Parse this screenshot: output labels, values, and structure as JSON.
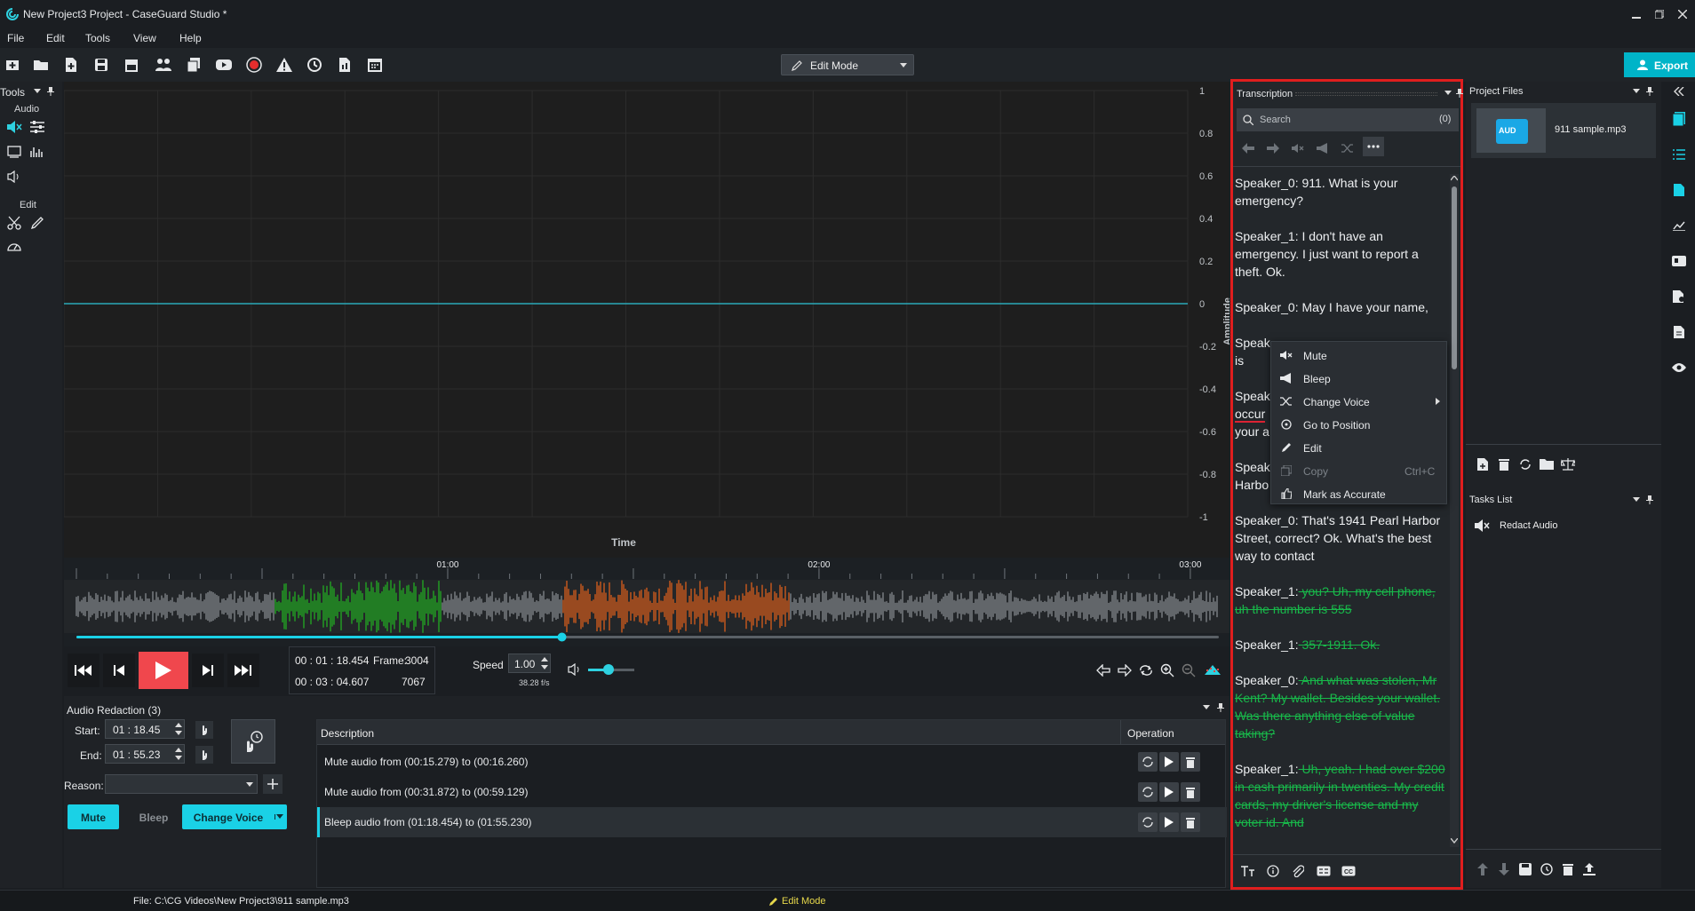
{
  "window": {
    "title": "New Project3 Project - CaseGuard Studio *"
  },
  "menu": [
    "File",
    "Edit",
    "Tools",
    "View",
    "Help"
  ],
  "toolbar": {
    "mode": "Edit Mode",
    "export": "Export"
  },
  "tools_panel": {
    "title": "Tools",
    "audio": "Audio",
    "edit": "Edit"
  },
  "chart_data": {
    "type": "line",
    "ylabel": "Amplitude",
    "xlabel": "Time",
    "y_ticks": [
      "1",
      "0.8",
      "0.6",
      "0.4",
      "0.2",
      "0",
      "-0.2",
      "-0.4",
      "-0.6",
      "-0.8",
      "-1"
    ],
    "ylim": [
      -1,
      1
    ],
    "series": [
      {
        "values": [
          0,
          0
        ]
      }
    ],
    "grid": true
  },
  "timeline": {
    "ticks": [
      "01:00",
      "02:00",
      "03:00"
    ],
    "duration_seconds": 184.607,
    "playhead_seconds": 78.454,
    "selections": [
      {
        "start": 31.872,
        "end": 59.129,
        "color": "#22b722"
      },
      {
        "start": 78.454,
        "end": 115.23,
        "color": "#e8641a"
      }
    ]
  },
  "transport": {
    "current": "00 : 01 : 18.454",
    "total": "00 : 03 : 04.607",
    "frame_label": "Frame:",
    "frame": "3004",
    "frame_total": "7067",
    "speed_label": "Speed",
    "speed": "1.00",
    "fps": "38.28 f/s",
    "volume": 0.45
  },
  "redaction": {
    "title": "Audio Redaction (3)",
    "start_label": "Start:",
    "start": "01 : 18.45",
    "end_label": "End:",
    "end": "01 : 55.23",
    "reason_label": "Reason:",
    "mute": "Mute",
    "bleep": "Bleep",
    "change_voice": "Change Voice",
    "col_description": "Description",
    "col_operation": "Operation",
    "rows": [
      {
        "description": "Mute audio from (00:15.279) to (00:16.260)"
      },
      {
        "description": "Mute audio from (00:31.872) to (00:59.129)"
      },
      {
        "description": "Bleep audio from (01:18.454) to (01:55.230)"
      }
    ]
  },
  "transcription": {
    "title": "Transcription",
    "search_placeholder": "Search",
    "search_count": "(0)",
    "paragraphs": [
      {
        "speaker": "Speaker_0:",
        "text": " 911. What is your emergency?"
      },
      {
        "speaker": "Speaker_1:",
        "text": " I don't have an emergency. I just want to report a theft. Ok."
      },
      {
        "speaker": "Speaker_0:",
        "text": " May I have your name,"
      },
      {
        "speaker": "Speak",
        "text": "",
        "line2": "is"
      },
      {
        "speaker": "Speak",
        "text": "",
        "line2": "occur",
        "line3": "your a"
      },
      {
        "speaker": "Speak",
        "text": "",
        "line2": "Harbo"
      },
      {
        "speaker": "Speaker_0:",
        "text": " That's 1941 Pearl Harbor Street, correct? Ok. What's the best way to contact"
      },
      {
        "speaker": "Speaker_1:",
        "strike": " you? Uh, my cell phone, uh the number is 555"
      },
      {
        "speaker": "Speaker_1:",
        "strike": " 357-1911. Ok."
      },
      {
        "speaker": "Speaker_0:",
        "strike": " And what was stolen, Mr Kent? My wallet. Besides your wallet. Was there anything else of value taking?"
      },
      {
        "speaker": "Speaker_1:",
        "strike": " Uh, yeah. I had over $200 in cash primarily in twenties. My credit cards, my driver's license and my voter id. And"
      }
    ],
    "context_menu": [
      {
        "label": "Mute",
        "icon": "mute-icon"
      },
      {
        "label": "Bleep",
        "icon": "megaphone-icon"
      },
      {
        "label": "Change Voice",
        "icon": "shuffle-icon",
        "submenu": true
      },
      {
        "label": "Go to Position",
        "icon": "target-icon"
      },
      {
        "label": "Edit",
        "icon": "pencil-icon"
      },
      {
        "label": "Copy",
        "icon": "copy-icon",
        "shortcut": "Ctrl+C",
        "disabled": true
      },
      {
        "label": "Mark as Accurate",
        "icon": "thumbs-up-icon"
      }
    ]
  },
  "project_files": {
    "title": "Project Files",
    "file": "911 sample.mp3",
    "thumb": "AUD"
  },
  "tasks": {
    "title": "Tasks List",
    "item": "Redact Audio"
  },
  "status": {
    "file": "File: C:\\CG Videos\\New Project3\\911 sample.mp3",
    "mode": "Edit Mode"
  }
}
